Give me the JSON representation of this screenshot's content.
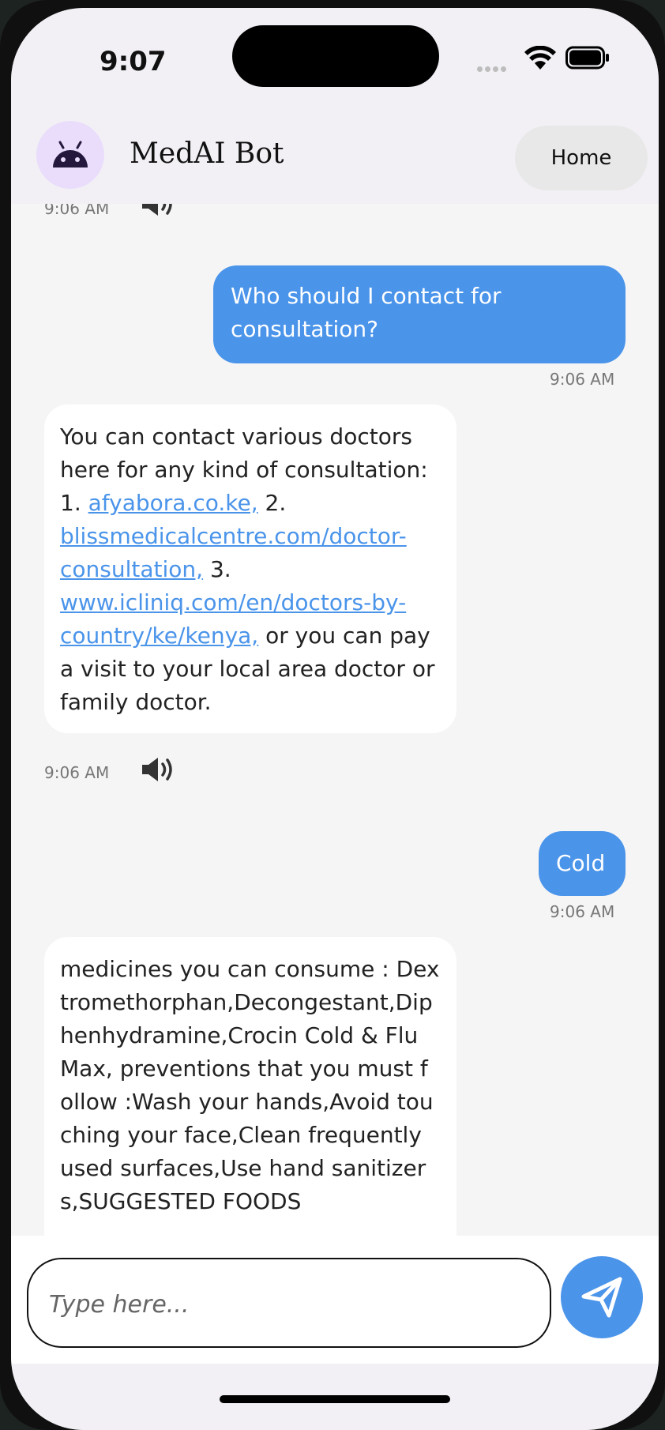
{
  "status_bar": {
    "time": "9:07"
  },
  "header": {
    "title": "MedAI Bot",
    "home_label": "Home",
    "avatar_icon": "android-icon"
  },
  "messages": [
    {
      "role": "bot",
      "timestamp": "9:06 AM"
    },
    {
      "role": "user",
      "text": "Who should I contact for consultation?",
      "timestamp": "9:06 AM"
    },
    {
      "role": "bot",
      "text_parts": [
        "You can contact various doctors here for any kind of consultation: 1. ",
        "afyabora.co.ke,",
        " 2. ",
        "blissmedicalcentre.com/doctor-consultation,",
        " 3. ",
        "www.icliniq.com/en/doctors-by-country/ke/kenya,",
        " or you can pay a visit to your local area doctor or family doctor."
      ],
      "timestamp": "9:06 AM"
    },
    {
      "role": "user",
      "text": "Cold",
      "timestamp": "9:06 AM"
    },
    {
      "role": "bot",
      "text": "medicines you can consume : Dextromethorphan,Decongestant,Diphenhydramine,Crocin Cold & Flu Max, preventions that you must follow :Wash your hands,Avoid touching your face,Clean frequently used surfaces,Use hand sanitizers,SUGGESTED FOODS"
    }
  ],
  "input": {
    "placeholder": "Type here..."
  },
  "colors": {
    "accent": "#4a94ea",
    "avatar_bg": "#e9ddfb",
    "header_bg": "#f2f0f5"
  }
}
